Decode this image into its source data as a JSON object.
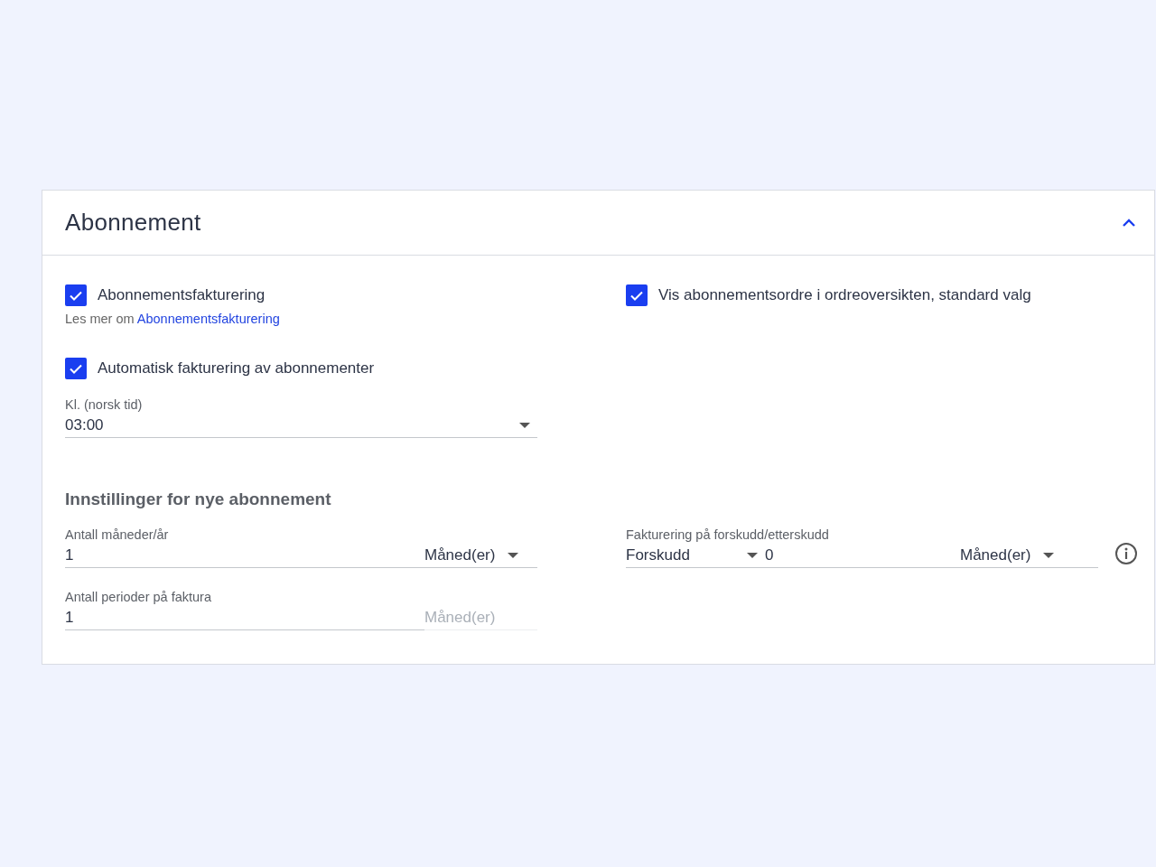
{
  "panel": {
    "title": "Abonnement",
    "expanded": true
  },
  "options": [
    {
      "label": "Abonnementsfakturering",
      "checked": true,
      "help": "Les mer om",
      "help_link": "Abonnementsfakturering"
    },
    {
      "label": "Vis abonnementsordre i ordreoversikten, standard valg",
      "checked": true
    },
    {
      "label": "Automatisk fakturering av abonnementer",
      "checked": true
    }
  ],
  "time_select": {
    "label": "Kl. (norsk tid)",
    "value": "03:00"
  },
  "section_title": "Innstillinger for nye abonnement",
  "months_field": {
    "label": "Antall måneder/år",
    "value": "1",
    "unit": "Måned(er)",
    "unit_disabled": false
  },
  "billing_field": {
    "label": "Fakturering på forskudd/etterskudd",
    "mode": "Forskudd",
    "value": "0",
    "unit": "Måned(er)"
  },
  "periods_field": {
    "label": "Antall perioder på faktura",
    "value": "1",
    "unit": "Måned(er)",
    "unit_disabled": true
  }
}
